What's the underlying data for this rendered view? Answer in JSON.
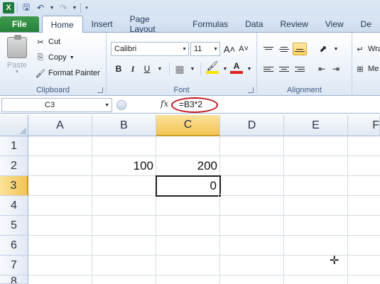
{
  "qat": {
    "app_icon": "X",
    "save_icon": "floppy-disk",
    "undo_icon": "undo-arrow",
    "redo_icon": "redo-arrow"
  },
  "tabs": [
    "File",
    "Home",
    "Insert",
    "Page Layout",
    "Formulas",
    "Data",
    "Review",
    "View",
    "De"
  ],
  "ribbon": {
    "clipboard": {
      "paste": "Paste",
      "cut": "Cut",
      "copy": "Copy",
      "format_painter": "Format Painter",
      "label": "Clipboard"
    },
    "font": {
      "name": "Calibri",
      "size": "11",
      "bold": "B",
      "italic": "I",
      "underline": "U",
      "label": "Font"
    },
    "alignment": {
      "wrap": "Wra",
      "merge": "Me",
      "label": "Alignment"
    }
  },
  "formula_bar": {
    "name_box": "C3",
    "fx": "fx",
    "formula": "=B3*2"
  },
  "columns": [
    "A",
    "B",
    "C",
    "D",
    "E",
    "F"
  ],
  "rows": [
    "1",
    "2",
    "3",
    "4",
    "5",
    "6",
    "7",
    "8"
  ],
  "cells": {
    "B2": "100",
    "C2": "200",
    "C3": "0"
  },
  "colors": {
    "file_tab": "#27823a",
    "selected_header": "#f2c452",
    "highlight_ring": "#c0141c"
  }
}
